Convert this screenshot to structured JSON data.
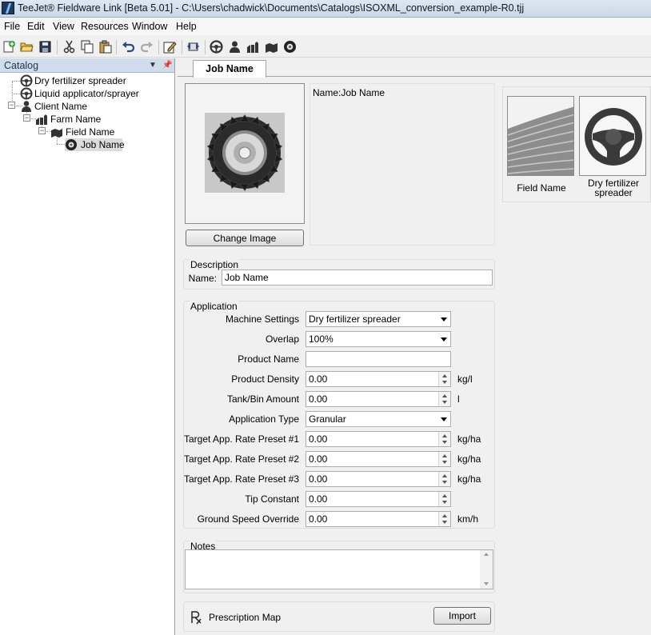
{
  "window": {
    "title": "TeeJet® Fieldware Link [Beta 5.01] - C:\\Users\\chadwick\\Documents\\Catalogs\\ISOXML_conversion_example-R0.tjj"
  },
  "menu": [
    "File",
    "Edit",
    "View",
    "Resources",
    "Window",
    "Help"
  ],
  "toolbar": {
    "icons": [
      "new-icon",
      "open-icon",
      "save-icon",
      "cut-icon",
      "copy-icon",
      "paste-icon",
      "undo-icon",
      "redo-icon",
      "edit-icon",
      "transfer-icon",
      "machine-icon",
      "client-icon",
      "farm-icon",
      "field-icon",
      "job-icon"
    ]
  },
  "catalog": {
    "title": "Catalog",
    "tree": [
      {
        "label": "Dry fertilizer spreader",
        "icon": "steering-wheel-icon"
      },
      {
        "label": "Liquid applicator/sprayer",
        "icon": "steering-wheel-icon"
      },
      {
        "label": "Client Name",
        "icon": "person-icon"
      },
      {
        "label": "Farm Name",
        "icon": "farm-icon"
      },
      {
        "label": "Field Name",
        "icon": "field-icon"
      },
      {
        "label": "Job Name",
        "icon": "tire-icon"
      }
    ]
  },
  "tab": {
    "label": "Job Name"
  },
  "image": {
    "change_label": "Change Image"
  },
  "name_info": "Name:Job Name",
  "thumbs": [
    {
      "label": "Field Name",
      "icon": "field-image-icon"
    },
    {
      "label": "Dry fertilizer spreader",
      "icon": "steering-wheel-icon"
    }
  ],
  "description": {
    "title": "Description",
    "name_label": "Name:",
    "name_value": "Job Name"
  },
  "application": {
    "title": "Application",
    "machine_settings": {
      "label": "Machine Settings",
      "value": "Dry fertilizer spreader"
    },
    "overlap": {
      "label": "Overlap",
      "value": "100%"
    },
    "product_name": {
      "label": "Product Name",
      "value": ""
    },
    "product_density": {
      "label": "Product Density",
      "value": "0.00",
      "unit": "kg/l"
    },
    "tank_bin": {
      "label": "Tank/Bin Amount",
      "value": "0.00",
      "unit": "l"
    },
    "application_type": {
      "label": "Application Type",
      "value": "Granular"
    },
    "preset1": {
      "label": "Target App. Rate Preset #1",
      "value": "0.00",
      "unit": "kg/ha"
    },
    "preset2": {
      "label": "Target App. Rate Preset #2",
      "value": "0.00",
      "unit": "kg/ha"
    },
    "preset3": {
      "label": "Target App. Rate Preset #3",
      "value": "0.00",
      "unit": "kg/ha"
    },
    "tip_constant": {
      "label": "Tip Constant",
      "value": "0.00"
    },
    "ground_speed": {
      "label": "Ground Speed Override",
      "value": "0.00",
      "unit": "km/h"
    }
  },
  "notes": {
    "title": "Notes",
    "value": ""
  },
  "prescription": {
    "label": "Prescription Map",
    "import_label": "Import"
  }
}
